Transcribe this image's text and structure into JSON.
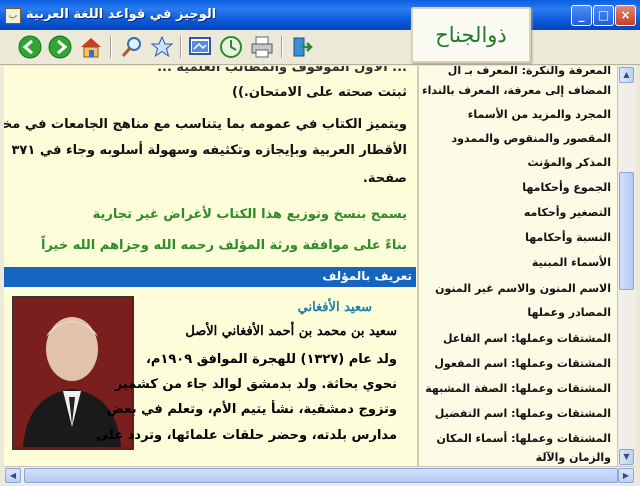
{
  "window": {
    "title": "الوجيز في قواعد اللغة العربية",
    "controls": {
      "minimize": "_",
      "maximize": "□",
      "close": "×"
    }
  },
  "brand": {
    "text": "ذوالجناح"
  },
  "toolbar": {
    "buttons": [
      "back-icon",
      "forward-icon",
      "home-icon",
      "search-icon",
      "favorites-icon",
      "display-icon",
      "refresh-icon",
      "print-icon",
      "exit-icon"
    ]
  },
  "content": {
    "line_cut_top": "... الأول الموقوف والمطالب العلمية ... ",
    "paragraph_1_end": "ثبتت صحته على الامتحان.))",
    "paragraph_2": [
      "ويتميز الكتاب في عمومه بما يتناسب مع مناهج الجامعات في مختلف",
      "الأقطار العربية وبإيجازه وتكثيفه وسهولة أسلوبه وجاء في ٣٧١",
      "صفحة."
    ],
    "notice_1": "يسمح بنسخ وتوزيع هذا الكتاب لأغراض غير تجارية",
    "notice_2": "بناءً على موافقة ورثة المؤلف رحمه الله وجزاهم الله خيراً",
    "section_title": "تعريف بالمؤلف",
    "author_name": "سعيد الأفغاني",
    "bio": [
      "سعيد بن محمد بن أحمد الأفغاني الأصل",
      "ولد عام (١٣٢٧) للهجرة الموافق ١٩٠٩م،",
      "نحوي بحاثة. ولد بدمشق لوالد جاء من كشمير",
      "وتزوج دمشقية، نشأ يتيم الأم، وتعلم في بعض",
      "مدارس بلدته، وحضر حلقات علمائها، وتردد على"
    ]
  },
  "nav": {
    "items": [
      "المعرفة والنكرة: المعرف بـ أل",
      "المضاف إلى معرفة، المعرف بالنداء",
      "المجرد والمزيد من الأسماء",
      "المقصور والمنقوص والممدود",
      "المذكر والمؤنث",
      "الجموع وأحكامها",
      "التصغير وأحكامه",
      "النسبة وأحكامها",
      "الأسماء المبنية",
      "الاسم المنون والاسم غير المنون",
      "المصادر وعملها",
      "المشتقات وعملها: اسم الفاعل",
      "المشتقات وعملها: اسم المفعول",
      "المشتقات وعملها: الصفة المشبهة",
      "المشتقات وعملها: اسم التفضيل",
      "المشتقات وعملها: أسماء المكان",
      "والزمان والآلة"
    ]
  },
  "colors": {
    "title_blue": "#0b57d8",
    "content_bg": "#fefdd9",
    "nav_bg": "#fbfbe6",
    "section_blue": "#1565c0",
    "accent_green": "#2e8a2a",
    "author_teal": "#1f7ea6"
  }
}
